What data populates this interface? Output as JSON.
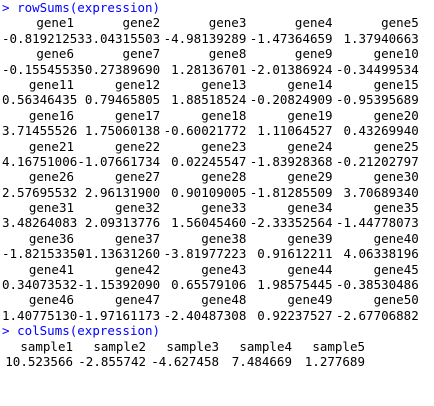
{
  "prompt": ">",
  "commands": {
    "row_sums": "rowSums(expression)",
    "col_sums": "colSums(expression)"
  },
  "row_sums_output": [
    {
      "names": [
        "gene1",
        "gene2",
        "gene3",
        "gene4",
        "gene5"
      ],
      "values": [
        "-0.81921253",
        "3.04315503",
        "-4.98139289",
        "-1.47364659",
        "1.37940663"
      ]
    },
    {
      "names": [
        "gene6",
        "gene7",
        "gene8",
        "gene9",
        "gene10"
      ],
      "values": [
        "-0.15545535",
        "-0.27389690",
        "1.28136701",
        "-2.01386924",
        "-0.34499534"
      ]
    },
    {
      "names": [
        "gene11",
        "gene12",
        "gene13",
        "gene14",
        "gene15"
      ],
      "values": [
        "0.56346435",
        "0.79465805",
        "1.88518524",
        "-0.20824909",
        "-0.95395689"
      ]
    },
    {
      "names": [
        "gene16",
        "gene17",
        "gene18",
        "gene19",
        "gene20"
      ],
      "values": [
        "3.71455526",
        "1.75060138",
        "-0.60021772",
        "1.11064527",
        "0.43269940"
      ]
    },
    {
      "names": [
        "gene21",
        "gene22",
        "gene23",
        "gene24",
        "gene25"
      ],
      "values": [
        "4.16751006",
        "-1.07661734",
        "0.02245547",
        "-1.83928368",
        "-0.21202797"
      ]
    },
    {
      "names": [
        "gene26",
        "gene27",
        "gene28",
        "gene29",
        "gene30"
      ],
      "values": [
        "2.57695532",
        "2.96131900",
        "0.90109005",
        "-1.81285509",
        "3.70689340"
      ]
    },
    {
      "names": [
        "gene31",
        "gene32",
        "gene33",
        "gene34",
        "gene35"
      ],
      "values": [
        "3.48264083",
        "2.09313776",
        "1.56045460",
        "-2.33352564",
        "-1.44778073"
      ]
    },
    {
      "names": [
        "gene36",
        "gene37",
        "gene38",
        "gene39",
        "gene40"
      ],
      "values": [
        "-1.82153350",
        "-1.13631260",
        "-3.81977223",
        "0.91612211",
        "4.06338196"
      ]
    },
    {
      "names": [
        "gene41",
        "gene42",
        "gene43",
        "gene44",
        "gene45"
      ],
      "values": [
        "0.34073532",
        "-1.15392090",
        "0.65579106",
        "1.98575445",
        "-0.38530486"
      ]
    },
    {
      "names": [
        "gene46",
        "gene47",
        "gene48",
        "gene49",
        "gene50"
      ],
      "values": [
        "1.40775130",
        "-1.97161173",
        "-2.40487308",
        "0.92237527",
        "-2.67706882"
      ]
    }
  ],
  "col_sums_output": {
    "names": [
      "sample1",
      "sample2",
      "sample3",
      "sample4",
      "sample5"
    ],
    "values": [
      "10.523566",
      "-2.855742",
      "-4.627458",
      "7.484669",
      "1.277689"
    ]
  }
}
